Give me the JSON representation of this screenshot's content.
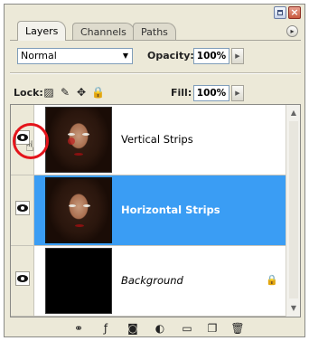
{
  "tabs": {
    "items": [
      "Layers",
      "Channels",
      "Paths"
    ],
    "active": "Layers"
  },
  "blend_mode": {
    "value": "Normal"
  },
  "opacity": {
    "label": "Opacity:",
    "value": "100%"
  },
  "lock": {
    "label": "Lock:"
  },
  "fill": {
    "label": "Fill:",
    "value": "100%"
  },
  "layers": [
    {
      "name": "Vertical Strips",
      "selected": false,
      "visible": true
    },
    {
      "name": "Horizontal Strips",
      "selected": true,
      "visible": true
    },
    {
      "name": "Background",
      "selected": false,
      "visible": true,
      "locked": true
    }
  ],
  "icons": {
    "window": [
      "minimize-icon",
      "close-icon"
    ],
    "footer": [
      "link-layers-icon",
      "layer-style-icon",
      "layer-mask-icon",
      "adjustment-layer-icon",
      "new-group-icon",
      "new-layer-icon",
      "trash-icon"
    ]
  },
  "colors": {
    "selection": "#3a9df4",
    "panel": "#ece9d8",
    "highlight_circle": "#e4141b"
  }
}
